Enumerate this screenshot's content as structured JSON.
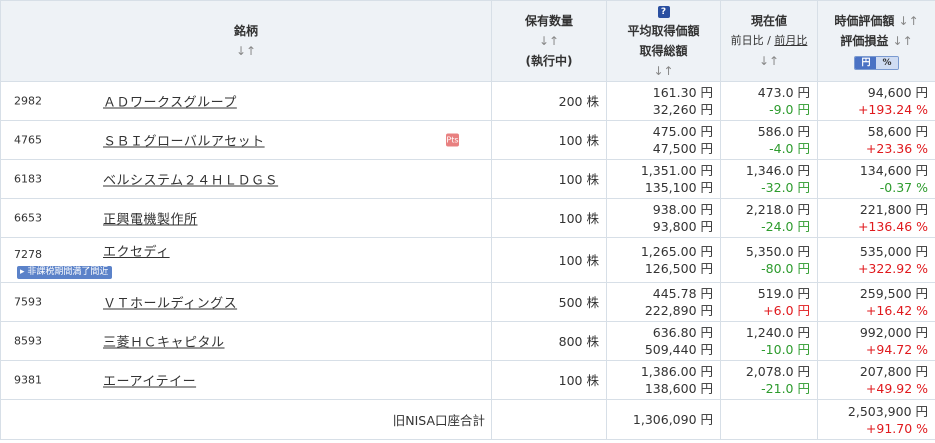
{
  "header": {
    "name": "銘柄",
    "sort_arrows": "↓↑",
    "qty_line1": "保有数量",
    "qty_line3": "(執行中)",
    "help_icon_text": "?",
    "avg_line1": "平均取得価額",
    "avg_line2": "取得総額",
    "cur_line1": "現在値",
    "cur_sub1": "前日比",
    "cur_sep": " / ",
    "cur_sub2": "前月比",
    "val_line1": "時価評価額",
    "val_line2": "評価損益",
    "toggle_yen": "円",
    "toggle_pct": "%"
  },
  "rows": [
    {
      "code": "2982",
      "name": "ＡＤワークスグループ",
      "qty": "200 株",
      "avg": "161.30 円",
      "total": "32,260 円",
      "price": "473.0 円",
      "change": "-9.0 円",
      "change_color": "green",
      "value": "94,600 円",
      "pl": "+193.24 %",
      "pl_color": "red"
    },
    {
      "code": "4765",
      "name": "ＳＢＩグローバルアセット",
      "qty": "100 株",
      "avg": "475.00 円",
      "total": "47,500 円",
      "price": "586.0 円",
      "change": "-4.0 円",
      "change_color": "green",
      "value": "58,600 円",
      "pl": "+23.36 %",
      "pl_color": "red",
      "icon_text": "Pts"
    },
    {
      "code": "6183",
      "name": "ベルシステム２４ＨＬＤＧＳ",
      "qty": "100 株",
      "avg": "1,351.00 円",
      "total": "135,100 円",
      "price": "1,346.0 円",
      "change": "-32.0 円",
      "change_color": "green",
      "value": "134,600 円",
      "pl": "-0.37 %",
      "pl_color": "green"
    },
    {
      "code": "6653",
      "name": "正興電機製作所",
      "qty": "100 株",
      "avg": "938.00 円",
      "total": "93,800 円",
      "price": "2,218.0 円",
      "change": "-24.0 円",
      "change_color": "green",
      "value": "221,800 円",
      "pl": "+136.46 %",
      "pl_color": "red"
    },
    {
      "code": "7278",
      "name": "エクセディ",
      "qty": "100 株",
      "avg": "1,265.00 円",
      "total": "126,500 円",
      "price": "5,350.0 円",
      "change": "-80.0 円",
      "change_color": "green",
      "value": "535,000 円",
      "pl": "+322.92 %",
      "pl_color": "red",
      "badge": "▸ 非課税期間満了間近"
    },
    {
      "code": "7593",
      "name": "ＶＴホールディングス",
      "qty": "500 株",
      "avg": "445.78 円",
      "total": "222,890 円",
      "price": "519.0 円",
      "change": "+6.0 円",
      "change_color": "red",
      "value": "259,500 円",
      "pl": "+16.42 %",
      "pl_color": "red"
    },
    {
      "code": "8593",
      "name": "三菱ＨＣキャピタル",
      "qty": "800 株",
      "avg": "636.80 円",
      "total": "509,440 円",
      "price": "1,240.0 円",
      "change": "-10.0 円",
      "change_color": "green",
      "value": "992,000 円",
      "pl": "+94.72 %",
      "pl_color": "red"
    },
    {
      "code": "9381",
      "name": "エーアイテイー",
      "qty": "100 株",
      "avg": "1,386.00 円",
      "total": "138,600 円",
      "price": "2,078.0 円",
      "change": "-21.0 円",
      "change_color": "green",
      "value": "207,800 円",
      "pl": "+49.92 %",
      "pl_color": "red"
    }
  ],
  "summary": {
    "label": "旧NISA口座合計",
    "total_cost": "1,306,090 円",
    "total_value": "2,503,900 円",
    "total_pl": "+91.70 %"
  }
}
